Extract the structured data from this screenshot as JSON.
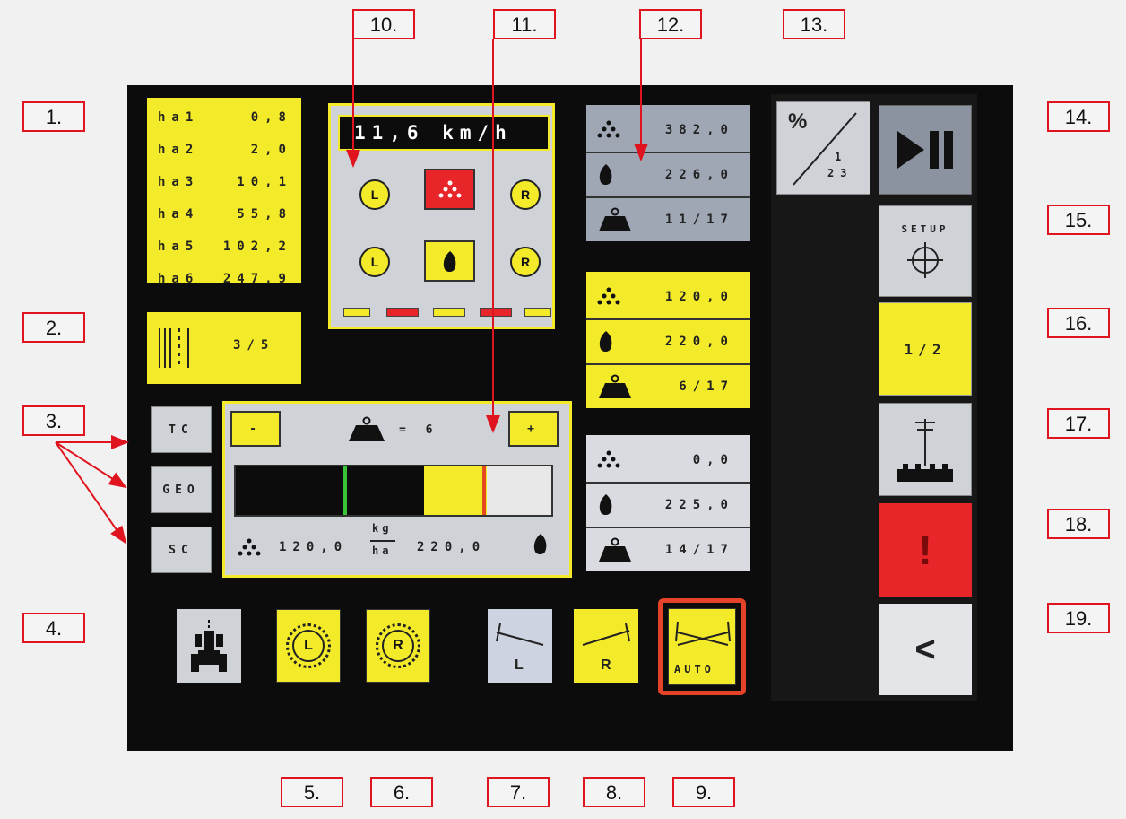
{
  "callouts": [
    "1.",
    "2.",
    "3.",
    "4.",
    "5.",
    "6.",
    "7.",
    "8.",
    "9.",
    "10.",
    "11.",
    "12.",
    "13.",
    "14.",
    "15.",
    "16.",
    "17.",
    "18.",
    "19."
  ],
  "hectares": [
    {
      "label": "ha1",
      "value": "0,8"
    },
    {
      "label": "ha2",
      "value": "2,0"
    },
    {
      "label": "ha3",
      "value": "10,1"
    },
    {
      "label": "ha4",
      "value": "55,8"
    },
    {
      "label": "ha5",
      "value": "102,2"
    },
    {
      "label": "ha6",
      "value": "247,9"
    }
  ],
  "rows": {
    "value": "3/5"
  },
  "speed": {
    "value": "11,6 km/h"
  },
  "sections": {
    "left_top": "L",
    "right_top": "R",
    "left_bottom": "L",
    "right_bottom": "R"
  },
  "mode_buttons": {
    "tc": "TC",
    "geo": "GEO",
    "sc": "SC"
  },
  "dose": {
    "minus": "-",
    "plus": "+",
    "equals": "= 6",
    "fertilizer_rate": "120,0",
    "seed_rate": "220,0",
    "unit_top": "kg",
    "unit_bottom": "ha",
    "bar_level_pct": 20
  },
  "product_panels": [
    {
      "fertilizer": "382,0",
      "seed": "226,0",
      "calibration": "11/17"
    },
    {
      "fertilizer": "120,0",
      "seed": "220,0",
      "calibration": "6/17"
    },
    {
      "fertilizer": "0,0",
      "seed": "225,0",
      "calibration": "14/17"
    }
  ],
  "right_buttons": {
    "percent_top": "%",
    "percent_mid": "1",
    "percent_bottom": "23",
    "setup": "SETUP",
    "half": "1/2",
    "alarm": "!",
    "back": "<"
  },
  "bottom_buttons": {
    "left_disc": "L",
    "right_disc": "R",
    "left_marker": "L",
    "right_marker": "R",
    "auto": "AUTO"
  },
  "colors": {
    "yellow": "#f3ea2a",
    "red": "#e8262a",
    "grey": "#cfd3d8",
    "screen": "#0c0c0c",
    "accent": "#e0141e"
  }
}
